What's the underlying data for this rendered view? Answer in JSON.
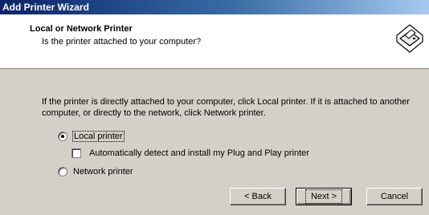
{
  "window": {
    "title": "Add Printer Wizard"
  },
  "header": {
    "title": "Local or Network Printer",
    "subtitle": "Is the printer attached to your computer?",
    "icon": "printer-icon"
  },
  "body": {
    "description": "If the printer is directly attached to your computer, click Local printer.  If it is attached to another computer, or directly to the network, click Network printer."
  },
  "options": {
    "local_printer": {
      "label": "Local printer",
      "selected": true
    },
    "auto_detect": {
      "label": "Automatically detect and install my Plug and Play printer",
      "checked": false
    },
    "network_printer": {
      "label": "Network printer",
      "selected": false
    }
  },
  "buttons": {
    "back": "< Back",
    "next": "Next >",
    "cancel": "Cancel"
  }
}
